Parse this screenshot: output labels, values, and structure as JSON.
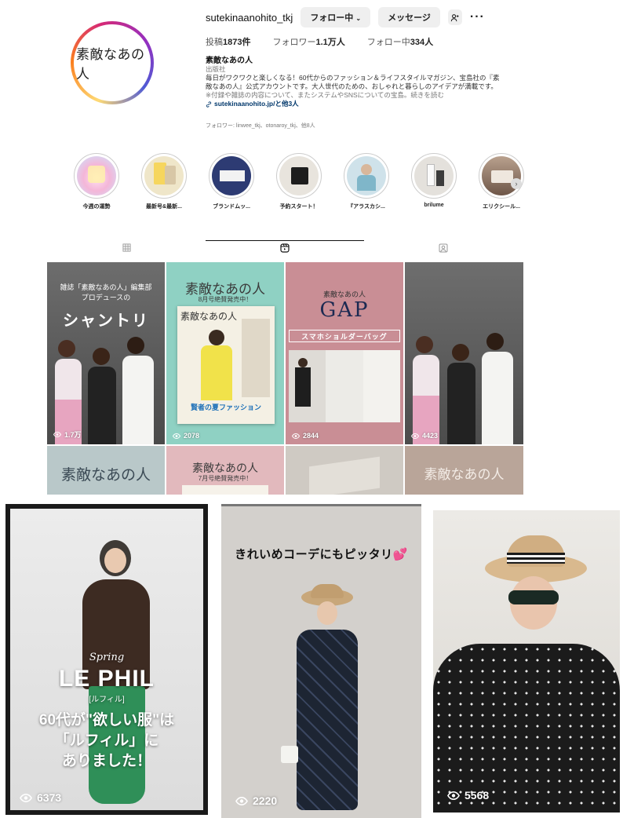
{
  "profile": {
    "username": "sutekinaanohito_tkj",
    "follow_label": "フォロー中",
    "message_label": "メッセージ",
    "avatar_text": "素敵なあの人",
    "stats": {
      "posts_label": "投稿",
      "posts_value": "1873件",
      "followers_label": "フォロワー",
      "followers_value": "1.1万人",
      "following_label": "フォロー中",
      "following_value": "334人"
    },
    "bio": {
      "name": "素敵なあの人",
      "category": "出版社",
      "line1": "毎日がワクワクと楽しくなる！60代からのファッション＆ライフスタイルマガジン、宝島社の『素",
      "line2": "敵なあの人』公式アカウントです。大人世代のための、おしゃれと暮らしのアイデアが満載です。",
      "line3": "※付録や雑誌の内容について、またシステムやSNSについての宝島。続きを読む",
      "link": "sutekinaanohito.jp/と他3人"
    },
    "followed_by": "フォロワー: linwee_tkj、otonaroy_tkj、他8人"
  },
  "highlights": [
    {
      "label": "今週の運勢",
      "color": "#f4b6d8"
    },
    {
      "label": "最新号&最新...",
      "color": "#e9dcb8"
    },
    {
      "label": "ブランドムッ...",
      "color": "#2d3b73"
    },
    {
      "label": "予約スタート！",
      "color": "#cfc9c0"
    },
    {
      "label": "『アラスカシ...",
      "color": "#b6d4e0"
    },
    {
      "label": "brilume",
      "color": "#e4e1dc"
    },
    {
      "label": "エリクシール...",
      "color": "#8c6e5e"
    }
  ],
  "grid": [
    {
      "caption": "雑誌「素敵なあの人」編集部 プロデュースの",
      "headline": "シャントリ",
      "views": "1.7万"
    },
    {
      "caption": "素敵なあの人",
      "sub": "8月号絶賛発売中！",
      "extra": "賢者の夏ファッション",
      "views": "2078"
    },
    {
      "caption": "素敵なあの人",
      "headline": "GAP",
      "sub": "スマホショルダーバッグ",
      "views": "2844"
    },
    {
      "views": "4423"
    },
    {
      "caption": "素敵なあの人"
    },
    {
      "caption": "素敵なあの人",
      "sub": "7月号絶賛発売中！"
    },
    {
      "caption": ""
    },
    {
      "caption": "素敵なあの人"
    }
  ],
  "reels": [
    {
      "title": "LE PHIL",
      "script": "Spring",
      "ruby": "[ルフィル]",
      "lines": [
        "60代が\"欲しい服\"は",
        "「ルフィル」に",
        "ありました！"
      ],
      "views": "6373"
    },
    {
      "headline": "きれいめコーデにもピッタリ",
      "views": "2220"
    },
    {
      "views": "5568"
    }
  ],
  "colors": {
    "accent": "#00376b",
    "button_bg": "#efefef"
  }
}
